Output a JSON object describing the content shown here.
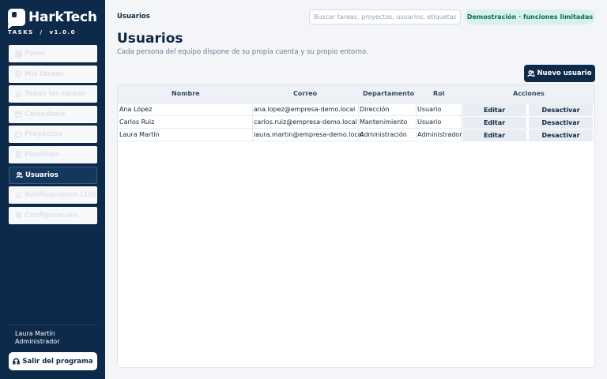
{
  "app": {
    "name": "HarkTech",
    "subtitle": "TASKS  /  v1.0.0"
  },
  "sidebar": {
    "items": [
      {
        "label": "Panel",
        "icon": "grid-icon"
      },
      {
        "label": "Mis tareas",
        "icon": "check-circle-icon"
      },
      {
        "label": "Todas las tareas",
        "icon": "list-icon"
      },
      {
        "label": "Calendario",
        "icon": "calendar-icon"
      },
      {
        "label": "Proyectos",
        "icon": "folder-icon"
      },
      {
        "label": "Plantillas",
        "icon": "template-icon"
      },
      {
        "label": "Usuarios",
        "icon": "users-icon",
        "active": true
      },
      {
        "label": "Notificaciones  (10)",
        "icon": "bell-icon"
      },
      {
        "label": "Configuración",
        "icon": "gear-icon"
      }
    ],
    "user": {
      "name": "Laura Martín",
      "role": "Administrador"
    },
    "logout_label": "Salir del programa"
  },
  "header": {
    "breadcrumb": "Usuarios",
    "search_placeholder": "Buscar tareas, proyectos, usuarios, etiquetas...",
    "demo_badge": "Demostración · funciones limitadas"
  },
  "page": {
    "title": "Usuarios",
    "description": "Cada persona del equipo dispone de su propia cuenta y su propio entorno.",
    "new_user_label": "Nuevo usuario"
  },
  "table": {
    "columns": [
      "Nombre",
      "Correo",
      "Departamento",
      "Rol",
      "Acciones"
    ],
    "rows": [
      {
        "name": "Ana López",
        "email": "ana.lopez@empresa-demo.local",
        "department": "Dirección",
        "role": "Usuario",
        "edit": "Editar",
        "deactivate": "Desactivar"
      },
      {
        "name": "Carlos Ruiz",
        "email": "carlos.ruiz@empresa-demo.local",
        "department": "Mantenimiento",
        "role": "Usuario",
        "edit": "Editar",
        "deactivate": "Desactivar"
      },
      {
        "name": "Laura Martín",
        "email": "laura.martin@empresa-demo.local",
        "department": "Administración",
        "role": "Administrador",
        "edit": "Editar",
        "deactivate": "Desactivar"
      }
    ]
  },
  "colors": {
    "sidebar_bg": "#0e2a4a",
    "accent": "#0e2a4a",
    "demo_badge_bg": "#d8f2ea",
    "demo_badge_text": "#0f6a52"
  }
}
